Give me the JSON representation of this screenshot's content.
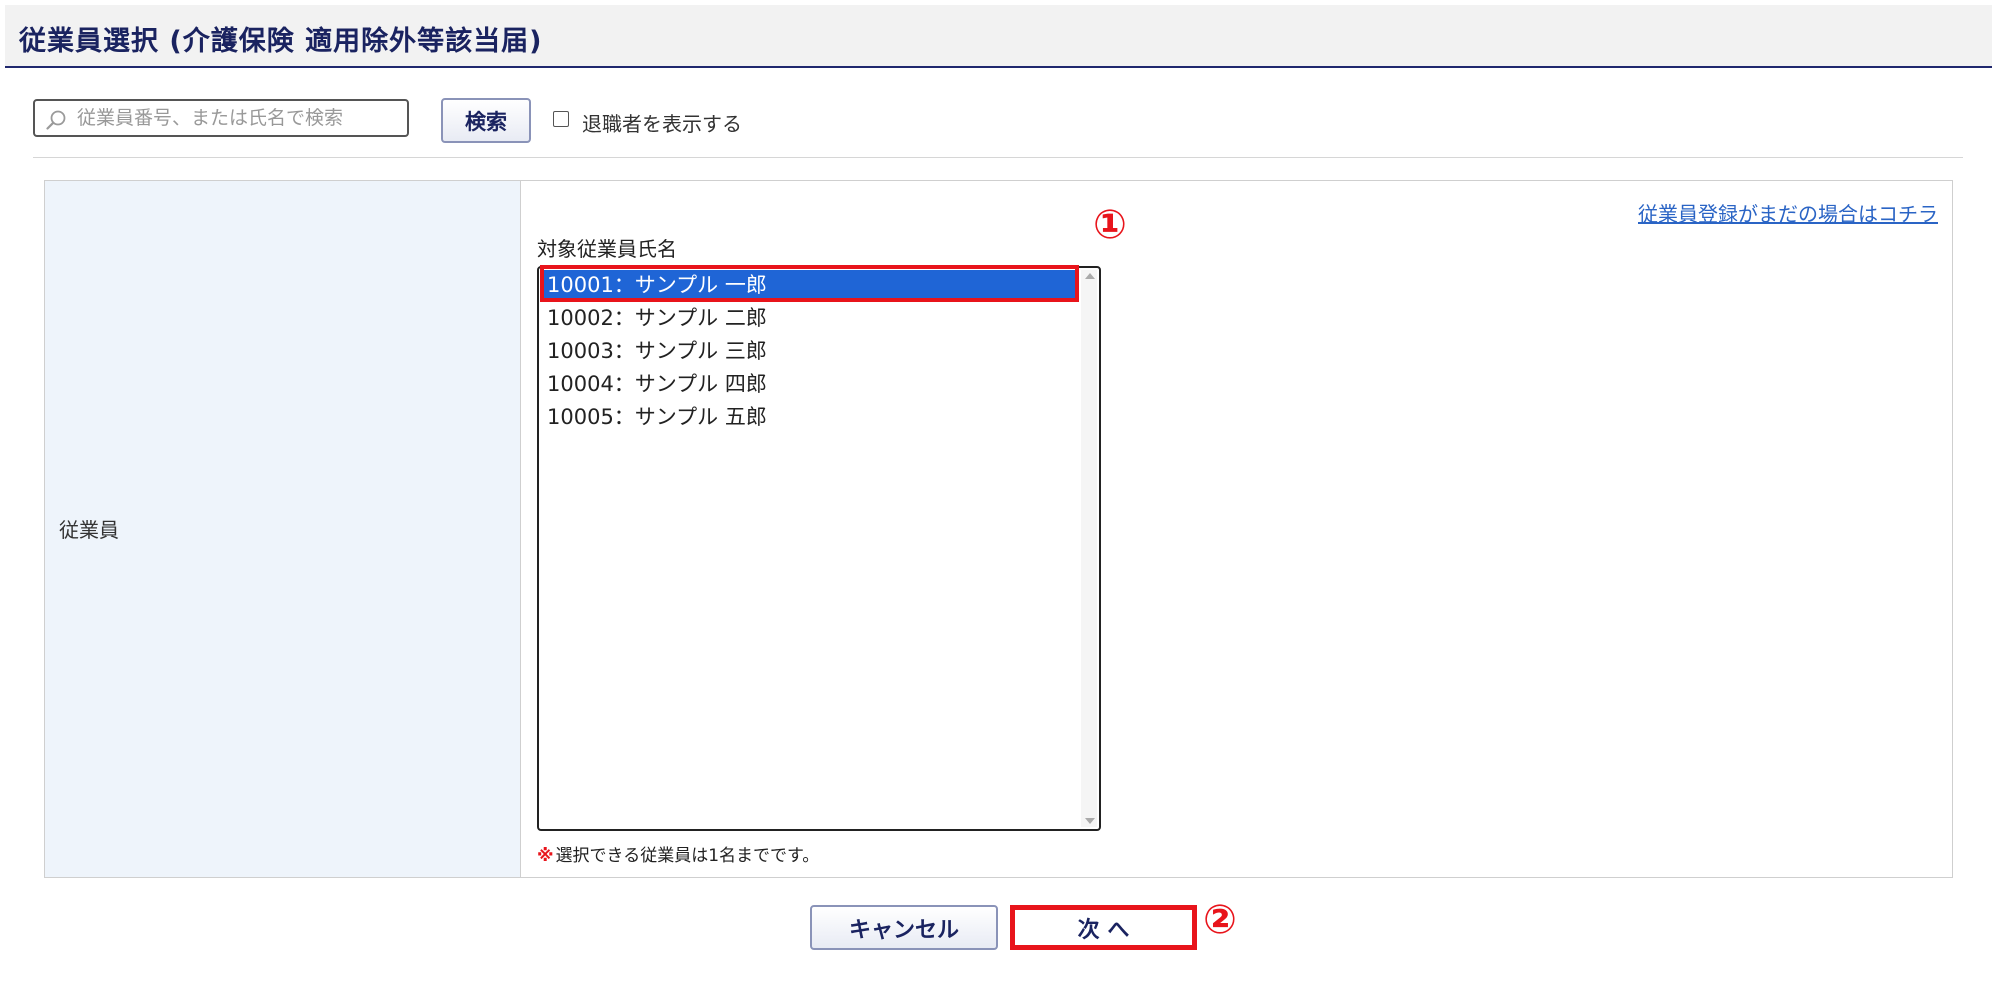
{
  "header": {
    "title": "従業員選択 (介護保険 適用除外等該当届)"
  },
  "search": {
    "placeholder": "従業員番号、または氏名で検索",
    "button_label": "検索",
    "show_retired_label": "退職者を表示する"
  },
  "form": {
    "row_label": "従業員",
    "register_link": "従業員登録がまだの場合はコチラ",
    "list_label": "対象従業員氏名",
    "employees": [
      "10001：サンプル 一郎",
      "10002：サンプル 二郎",
      "10003：サンプル 三郎",
      "10004：サンプル 四郎",
      "10005：サンプル 五郎"
    ],
    "selected_index": 0,
    "note_mark": "※",
    "note_text": "選択できる従業員は1名までです。"
  },
  "annotations": {
    "marker_1": "①",
    "marker_2": "②",
    "highlight_color": "#e8141b"
  },
  "actions": {
    "cancel_label": "キャンセル",
    "next_label": "次 へ"
  },
  "colors": {
    "title": "#1a2360",
    "selected_bg": "#1f65d6",
    "link": "#2a64c5",
    "label_bg": "#eef4fb"
  },
  "icons": {
    "search": "search-icon",
    "scroll_up": "scroll-up-arrow-icon",
    "scroll_down": "scroll-down-arrow-icon"
  }
}
